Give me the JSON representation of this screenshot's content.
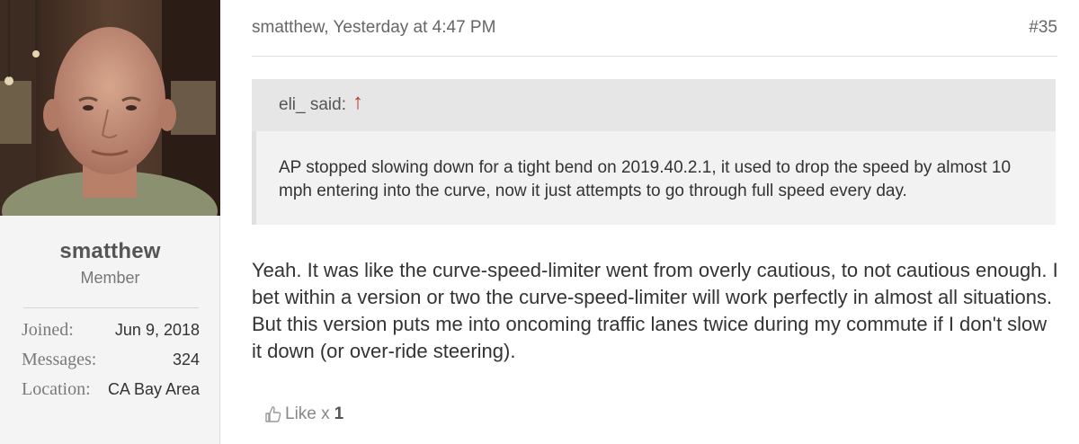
{
  "user": {
    "username": "smatthew",
    "role": "Member",
    "info": [
      {
        "label": "Joined:",
        "value": "Jun 9, 2018"
      },
      {
        "label": "Messages:",
        "value": "324"
      },
      {
        "label": "Location:",
        "value": "CA Bay Area"
      }
    ]
  },
  "post": {
    "meta": "smatthew, Yesterday at 4:47 PM",
    "number": "#35",
    "quote": {
      "author": "eli_ said:",
      "arrow": "↑",
      "text": "AP stopped slowing down for a tight bend on 2019.40.2.1, it used to drop the speed by almost 10 mph entering into the curve, now it just attempts to go through full speed every day."
    },
    "body": "Yeah. It was like the curve-speed-limiter went from overly cautious, to not cautious enough. I bet within a version or two the curve-speed-limiter will work perfectly in almost all situations. But this version puts me into oncoming traffic lanes twice during my commute if I don't slow it down (or over-ride steering).",
    "likes": {
      "label": "Like",
      "x": "x",
      "count": "1"
    }
  },
  "icons": {
    "like": "thumbs-up-icon",
    "quote_arrow": "up-arrow-icon"
  },
  "colors": {
    "quote_arrow": "#c0392b",
    "sidebar_bg": "#f4f4f4",
    "quote_bg": "#f2f2f2"
  }
}
